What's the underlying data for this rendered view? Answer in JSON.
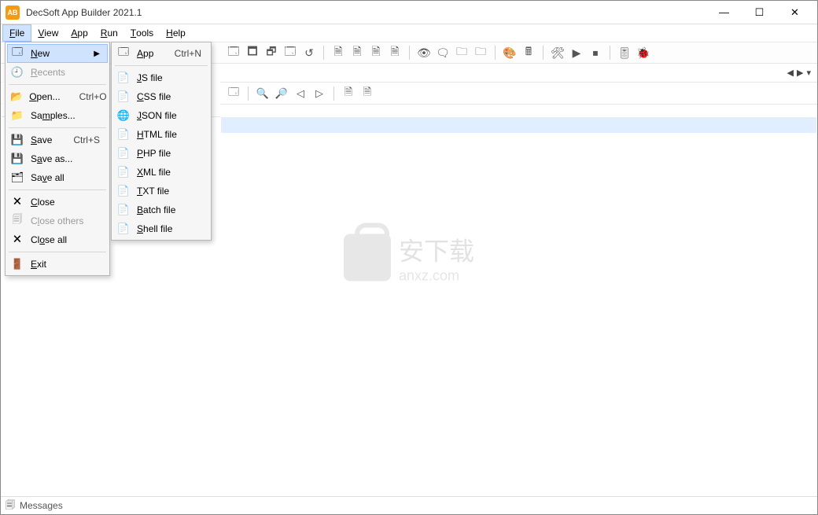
{
  "titlebar": {
    "icon_label": "AB",
    "title": "DecSoft App Builder 2021.1"
  },
  "menubar": [
    {
      "label": "File",
      "underline": "F",
      "open": true
    },
    {
      "label": "View",
      "underline": "V"
    },
    {
      "label": "App",
      "underline": "A"
    },
    {
      "label": "Run",
      "underline": "R"
    },
    {
      "label": "Tools",
      "underline": "T"
    },
    {
      "label": "Help",
      "underline": "H"
    }
  ],
  "file_menu": [
    {
      "icon": "🗔",
      "label": "New",
      "u": "N",
      "arrow": true,
      "highlight": true
    },
    {
      "icon": "🕘",
      "label": "Recents",
      "u": "R",
      "disabled": true
    },
    {
      "sep": true
    },
    {
      "icon": "📂",
      "label": "Open...",
      "u": "O",
      "short": "Ctrl+O"
    },
    {
      "icon": "📁",
      "label": "Samples...",
      "u": "m"
    },
    {
      "sep": true
    },
    {
      "icon": "💾",
      "label": "Save",
      "u": "S",
      "short": "Ctrl+S"
    },
    {
      "icon": "💾",
      "label": "Save as...",
      "u": "a"
    },
    {
      "icon": "🗂",
      "label": "Save all",
      "u": "v"
    },
    {
      "sep": true
    },
    {
      "icon": "🗙",
      "label": "Close",
      "u": "C"
    },
    {
      "icon": "🗐",
      "label": "Close others",
      "u": "l",
      "disabled": true
    },
    {
      "icon": "🗙",
      "label": "Close all",
      "u": "o"
    },
    {
      "sep": true
    },
    {
      "icon": "🚪",
      "label": "Exit",
      "u": "E"
    }
  ],
  "new_submenu": [
    {
      "icon": "🗔",
      "label": "App",
      "u": "A",
      "short": "Ctrl+N"
    },
    {
      "sep": true
    },
    {
      "icon": "📄",
      "label": "JS file",
      "u": "J"
    },
    {
      "icon": "📄",
      "label": "CSS file",
      "u": "C"
    },
    {
      "icon": "🌐",
      "label": "JSON file",
      "u": "J"
    },
    {
      "icon": "📄",
      "label": "HTML file",
      "u": "H"
    },
    {
      "icon": "📄",
      "label": "PHP file",
      "u": "P"
    },
    {
      "icon": "📄",
      "label": "XML file",
      "u": "X"
    },
    {
      "icon": "📄",
      "label": "TXT file",
      "u": "T"
    },
    {
      "icon": "📄",
      "label": "Batch file",
      "u": "B"
    },
    {
      "icon": "📄",
      "label": "Shell file",
      "u": "S"
    }
  ],
  "statusbar": {
    "label": "Messages"
  },
  "watermark": {
    "main": "安下载",
    "sub": "anxz.com"
  }
}
